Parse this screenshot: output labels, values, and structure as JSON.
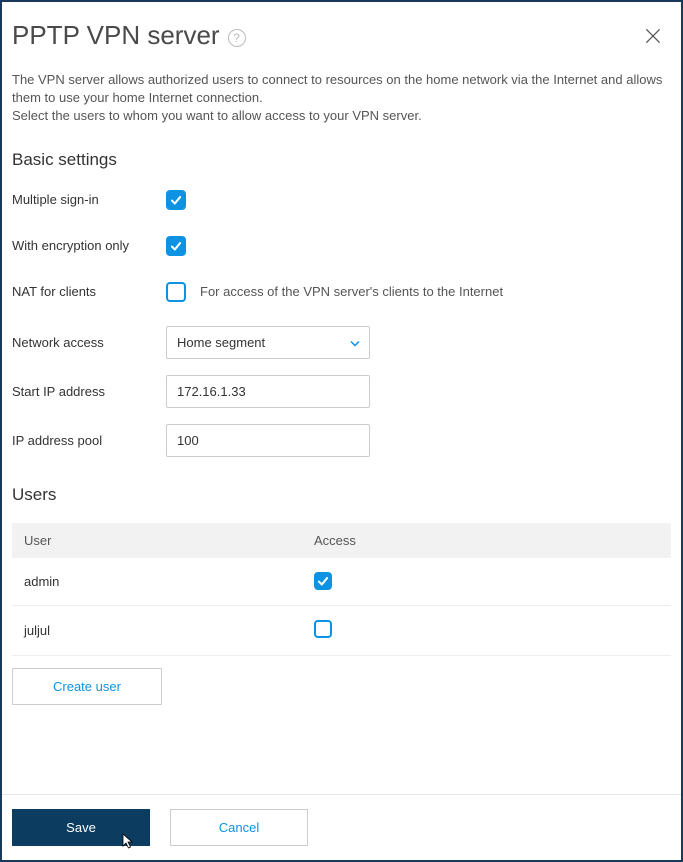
{
  "title": "PPTP VPN server",
  "description_line1": "The VPN server allows authorized users to connect to resources on the home network via the Internet and allows them to use your home Internet connection.",
  "description_line2": "Select the users to whom you want to allow access to your VPN server.",
  "basic_settings": {
    "title": "Basic settings",
    "multiple_signin": {
      "label": "Multiple sign-in",
      "checked": true
    },
    "encryption_only": {
      "label": "With encryption only",
      "checked": true
    },
    "nat_for_clients": {
      "label": "NAT for clients",
      "checked": false,
      "hint": "For access of the VPN server's clients to the Internet"
    },
    "network_access": {
      "label": "Network access",
      "value": "Home segment"
    },
    "start_ip": {
      "label": "Start IP address",
      "value": "172.16.1.33"
    },
    "ip_pool": {
      "label": "IP address pool",
      "value": "100"
    }
  },
  "users": {
    "title": "Users",
    "headers": {
      "user": "User",
      "access": "Access"
    },
    "rows": [
      {
        "name": "admin",
        "access": true
      },
      {
        "name": "juljul",
        "access": false
      }
    ],
    "create_label": "Create user"
  },
  "footer": {
    "save": "Save",
    "cancel": "Cancel"
  }
}
